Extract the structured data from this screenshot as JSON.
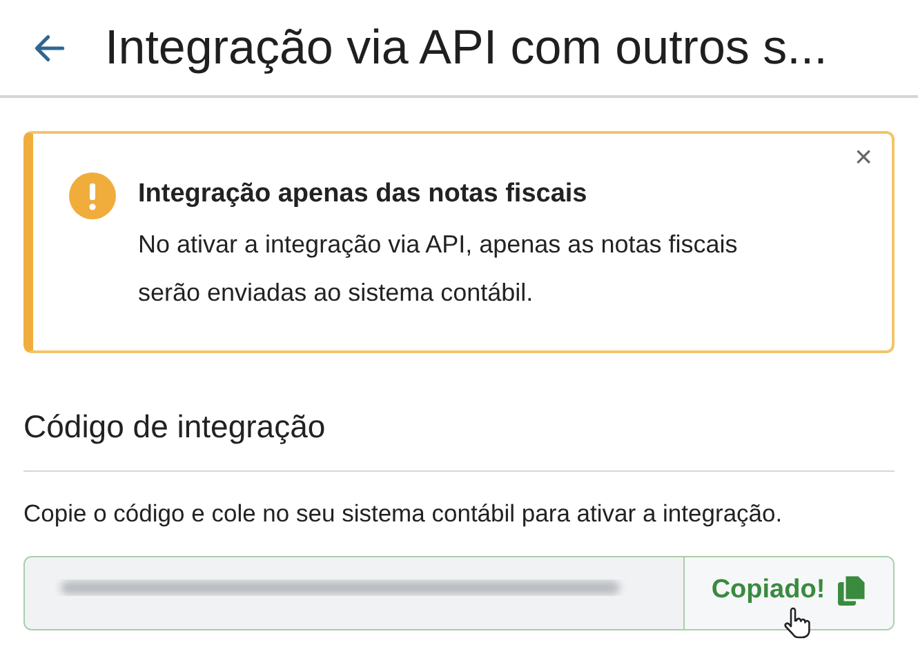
{
  "header": {
    "title": "Integração via API com outros s..."
  },
  "alert": {
    "title": "Integração apenas das notas fiscais",
    "message": "No ativar a integração via API, apenas as notas fiscais serão enviadas ao sistema contábil.",
    "close_label": "×"
  },
  "section": {
    "heading": "Código de integração",
    "description": "Copie o código e cole no seu sistema contábil para ativar a integração."
  },
  "code_field": {
    "button_label": "Copiado!",
    "copied": true
  }
}
